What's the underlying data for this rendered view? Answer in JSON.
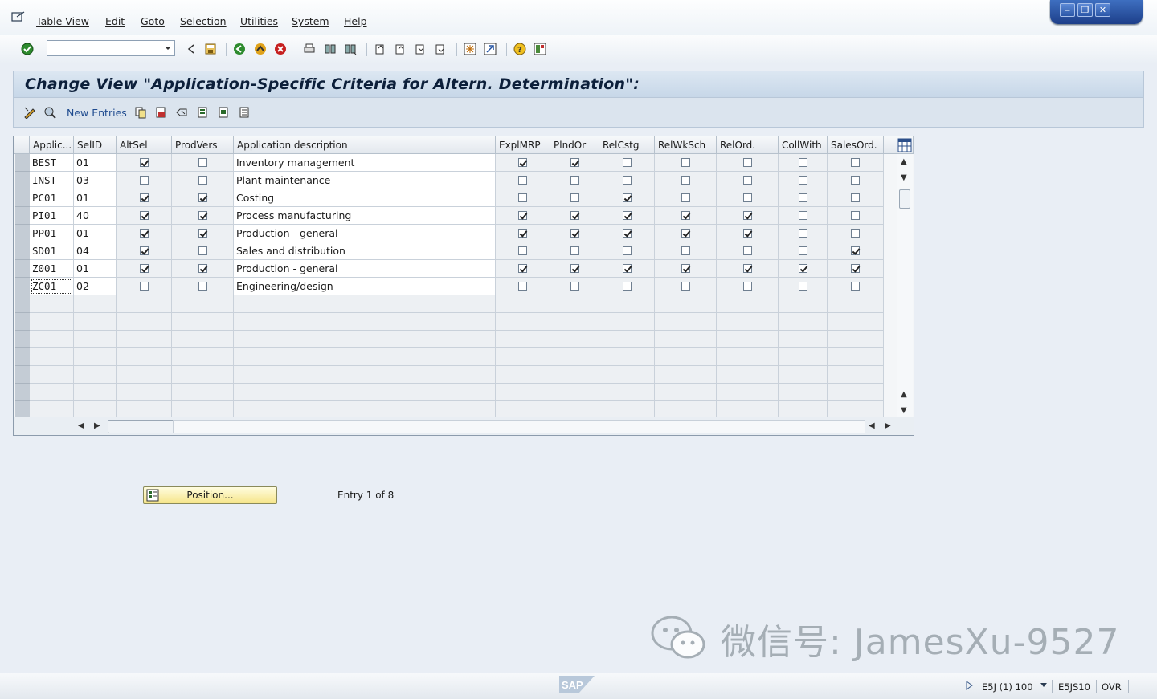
{
  "menubar": {
    "items": [
      "Table View",
      "Edit",
      "Goto",
      "Selection",
      "Utilities",
      "System",
      "Help"
    ]
  },
  "toolbar": {
    "command_field": "",
    "icons": [
      "enter-icon",
      "back-icon",
      "save-icon",
      "back-arrow-icon",
      "exit-icon",
      "cancel-icon",
      "print-icon",
      "find-icon",
      "find-next-icon",
      "first-page-icon",
      "prev-page-icon",
      "next-page-icon",
      "last-page-icon",
      "create-session-icon",
      "shortcut-icon",
      "help-icon",
      "layout-icon"
    ]
  },
  "title": "Change View \"Application-Specific Criteria for Altern. Determination\":",
  "app_toolbar": {
    "new_entries": "New Entries"
  },
  "table": {
    "headers": [
      "Applic...",
      "SelID",
      "AltSel",
      "ProdVers",
      "Application description",
      "ExplMRP",
      "PlndOr",
      "RelCstg",
      "RelWkSch",
      "RelOrd.",
      "CollWith",
      "SalesOrd."
    ],
    "rows": [
      {
        "app": "BEST",
        "selid": "01",
        "altsel": true,
        "prodvers": false,
        "desc": "Inventory management",
        "explmrp": true,
        "plndor": true,
        "relcstg": false,
        "relwksch": false,
        "relord": false,
        "collwith": false,
        "salesord": false
      },
      {
        "app": "INST",
        "selid": "03",
        "altsel": false,
        "prodvers": false,
        "desc": "Plant maintenance",
        "explmrp": false,
        "plndor": false,
        "relcstg": false,
        "relwksch": false,
        "relord": false,
        "collwith": false,
        "salesord": false
      },
      {
        "app": "PC01",
        "selid": "01",
        "altsel": true,
        "prodvers": true,
        "desc": "Costing",
        "explmrp": false,
        "plndor": false,
        "relcstg": true,
        "relwksch": false,
        "relord": false,
        "collwith": false,
        "salesord": false
      },
      {
        "app": "PI01",
        "selid": "40",
        "altsel": true,
        "prodvers": true,
        "desc": "Process manufacturing",
        "explmrp": true,
        "plndor": true,
        "relcstg": true,
        "relwksch": true,
        "relord": true,
        "collwith": false,
        "salesord": false
      },
      {
        "app": "PP01",
        "selid": "01",
        "altsel": true,
        "prodvers": true,
        "desc": "Production - general",
        "explmrp": true,
        "plndor": true,
        "relcstg": true,
        "relwksch": true,
        "relord": true,
        "collwith": false,
        "salesord": false
      },
      {
        "app": "SD01",
        "selid": "04",
        "altsel": true,
        "prodvers": false,
        "desc": "Sales and distribution",
        "explmrp": false,
        "plndor": false,
        "relcstg": false,
        "relwksch": false,
        "relord": false,
        "collwith": false,
        "salesord": true
      },
      {
        "app": "Z001",
        "selid": "01",
        "altsel": true,
        "prodvers": true,
        "desc": "Production - general",
        "explmrp": true,
        "plndor": true,
        "relcstg": true,
        "relwksch": true,
        "relord": true,
        "collwith": true,
        "salesord": true
      },
      {
        "app": "ZC01",
        "selid": "02",
        "altsel": false,
        "prodvers": false,
        "desc": "Engineering/design",
        "explmrp": false,
        "plndor": false,
        "relcstg": false,
        "relwksch": false,
        "relord": false,
        "collwith": false,
        "salesord": false
      }
    ],
    "empty_rows": 7
  },
  "position_button": "Position...",
  "entry_text": "Entry 1 of 8",
  "status": {
    "system": "E5J (1) 100",
    "server": "E5JS10",
    "mode": "OVR"
  },
  "watermark": "微信号: JamesXu-9527"
}
